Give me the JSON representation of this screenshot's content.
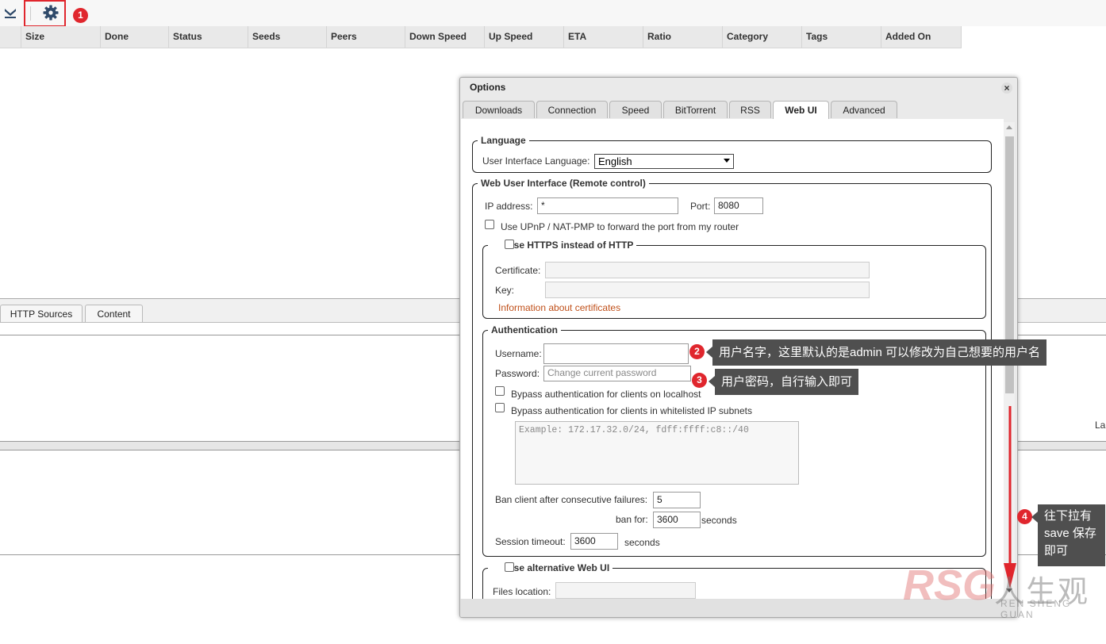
{
  "toolbar": {
    "download_icon": "download-arrow-icon",
    "settings_icon": "gear-icon"
  },
  "annotations": {
    "n1": "1",
    "n2": "2",
    "n3": "3",
    "n4": "4"
  },
  "table": {
    "columns": [
      "Size",
      "Done",
      "Status",
      "Seeds",
      "Peers",
      "Down Speed",
      "Up Speed",
      "ETA",
      "Ratio",
      "Category",
      "Tags",
      "Added On"
    ]
  },
  "lower": {
    "tabs": [
      "HTTP Sources",
      "Content"
    ],
    "right_text": "La"
  },
  "dialog": {
    "title": "Options",
    "close": "×",
    "tabs": [
      "Downloads",
      "Connection",
      "Speed",
      "BitTorrent",
      "RSS",
      "Web UI",
      "Advanced"
    ],
    "active_tab": "Web UI",
    "language": {
      "legend": "Language",
      "label": "User Interface Language:",
      "value": "English"
    },
    "webui": {
      "legend": "Web User Interface (Remote control)",
      "ip_label": "IP address:",
      "ip_value": "*",
      "port_label": "Port:",
      "port_value": "8080",
      "upnp_label": "Use UPnP / NAT-PMP to forward the port from my router"
    },
    "https": {
      "legend": "Use HTTPS instead of HTTP",
      "cert_label": "Certificate:",
      "key_label": "Key:",
      "info_link": "Information about certificates"
    },
    "auth": {
      "legend": "Authentication",
      "username_label": "Username:",
      "username_value": "",
      "password_label": "Password:",
      "password_placeholder": "Change current password",
      "bypass_localhost": "Bypass authentication for clients on localhost",
      "bypass_whitelist": "Bypass authentication for clients in whitelisted IP subnets",
      "subnet_placeholder": "Example: 172.17.32.0/24, fdff:ffff:c8::/40",
      "ban_failures_label": "Ban client after consecutive failures:",
      "ban_failures_value": "5",
      "ban_for_label": "ban for:",
      "ban_for_value": "3600",
      "ban_for_unit": "seconds",
      "session_label": "Session timeout:",
      "session_value": "3600",
      "session_unit": "seconds"
    },
    "alt_webui": {
      "legend": "Use alternative Web UI",
      "files_label": "Files location:"
    }
  },
  "tooltips": {
    "t2": "用户名字，这里默认的是admin 可以修改为自己想要的用户名",
    "t3": "用户密码，自行输入即可",
    "t4_l1": "往下拉有",
    "t4_l2": "save 保存",
    "t4_l3": "即可"
  },
  "watermark": {
    "logo": "RSG",
    "cn": "人生观",
    "en": "REN SHENG GUAN"
  },
  "colors": {
    "accent_red": "#e0262d",
    "tooltip_bg": "#4f4f4f",
    "link": "#c0501a"
  }
}
